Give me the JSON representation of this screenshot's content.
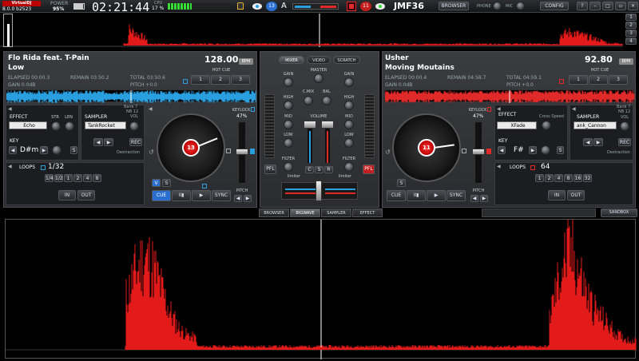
{
  "topbar": {
    "brand_top": "VirtualDJ",
    "version": "8.0.0 b2523",
    "power_label": "POWER",
    "power_value": "95%",
    "clock": "02:21:44",
    "cpu_label": "CPU",
    "cpu_value": "17 %",
    "deck_left_num": "13",
    "deck_right_num": "11",
    "letter_a": "A",
    "user_name": "JMF36",
    "browser_btn": "BROWSER",
    "phone_btn": "PHONE",
    "mic_btn": "MIC",
    "config_btn": "CONFIG",
    "side_numbers": [
      "1",
      "2",
      "3",
      "4"
    ]
  },
  "deck_left": {
    "artist": "Flo Rida feat. T-Pain",
    "title": "Low",
    "bpm": "128.00",
    "bpm_label": "BPM",
    "elapsed": "ELAPSED 00:00.3",
    "remain": "REMAIN 03:50.2",
    "total": "TOTAL 03:50.6",
    "gain": "GAIN 0.0dB",
    "pitch": "PITCH +0.0",
    "hot_cue_label": "HOT CUE",
    "hot_cues": [
      "1",
      "2",
      "3"
    ],
    "effect_label": "EFFECT",
    "effect_value": "Echo",
    "str_label": "STR",
    "len_label": "LEN",
    "sampler_label": "SAMPLER",
    "sampler_value": "TankRocket",
    "bank": "Bank 7",
    "nb": "NB 12",
    "vol_label": "VOL",
    "rec_label": "REC",
    "destraction": "Destraction",
    "key_label": "KEY",
    "key_value": "D#m",
    "keylock_label": "KEYLOCK",
    "keylock_value": "47%",
    "loops_label": "LOOPS",
    "loop_value": "1/32",
    "loop_sizes": [
      "1/4",
      "1/2",
      "1",
      "2",
      "4",
      "8"
    ],
    "in_label": "IN",
    "out_label": "OUT",
    "v_label": "V",
    "s_label": "S",
    "cue_label": "CUE",
    "play_label": "▶",
    "pause_label": "II▮",
    "sync_label": "SYNC",
    "pitch_label": "PITCH",
    "platter_num": "13",
    "accent": "#2a9fe0"
  },
  "deck_right": {
    "artist": "Usher",
    "title": "Moving Moutains",
    "bpm": "92.80",
    "bpm_label": "BPM",
    "elapsed": "ELAPSED 00:00.4",
    "remain": "REMAIN 04:58.7",
    "total": "TOTAL 04:59.1",
    "gain": "GAIN 0.0dB",
    "pitch": "PITCH +0.0",
    "hot_cue_label": "HOT CUE",
    "hot_cues": [
      "1",
      "2",
      "3"
    ],
    "effect_label": "EFFECT",
    "effect_value": "XFade",
    "cross_speed": "Cross Speed",
    "sampler_label": "SAMPLER",
    "sampler_value": "ank_Cannon",
    "bank": "Bank 7",
    "nb": "NB 12",
    "vol_label": "VOL",
    "rec_label": "REC",
    "destraction": "Destraction",
    "key_label": "KEY",
    "key_value": "F#",
    "keylock_label": "KEYLOCK",
    "keylock_value": "47%",
    "loops_label": "LOOPS",
    "loop_value": "64",
    "loop_sizes": [
      "1",
      "2",
      "4",
      "8",
      "16",
      "32"
    ],
    "in_label": "IN",
    "out_label": "OUT",
    "s_label": "S",
    "cue_label": "CUE",
    "play_label": "▶",
    "pause_label": "II▮",
    "sync_label": "SYNC",
    "pitch_label": "PITCH",
    "platter_num": "11",
    "accent": "#e02a2a"
  },
  "mixer": {
    "tabs": [
      "MIXER",
      "VIDEO",
      "SCRATCH"
    ],
    "active_tab": "MIXER",
    "gain": "GAIN",
    "master": "MASTER",
    "high": "HIGH",
    "c_mix": "C.MIX",
    "bal": "BAL",
    "mid": "MID",
    "volume": "VOLUME",
    "low": "LOW",
    "filter": "FILTER",
    "limiter": "limiter",
    "pfl": "PFL",
    "mid_buttons": [
      "C",
      "S",
      "R"
    ]
  },
  "bottom_tabs": [
    "BROWSER",
    "BIGWAVE",
    "SAMPLER",
    "EFFECT"
  ],
  "bottom_active": "BIGWAVE",
  "sandbox_label": "SANDBOX",
  "colors": {
    "wave_red": "#e21a1a",
    "deck_blue": "#2a9fe0",
    "deck_red": "#e02a2a"
  }
}
